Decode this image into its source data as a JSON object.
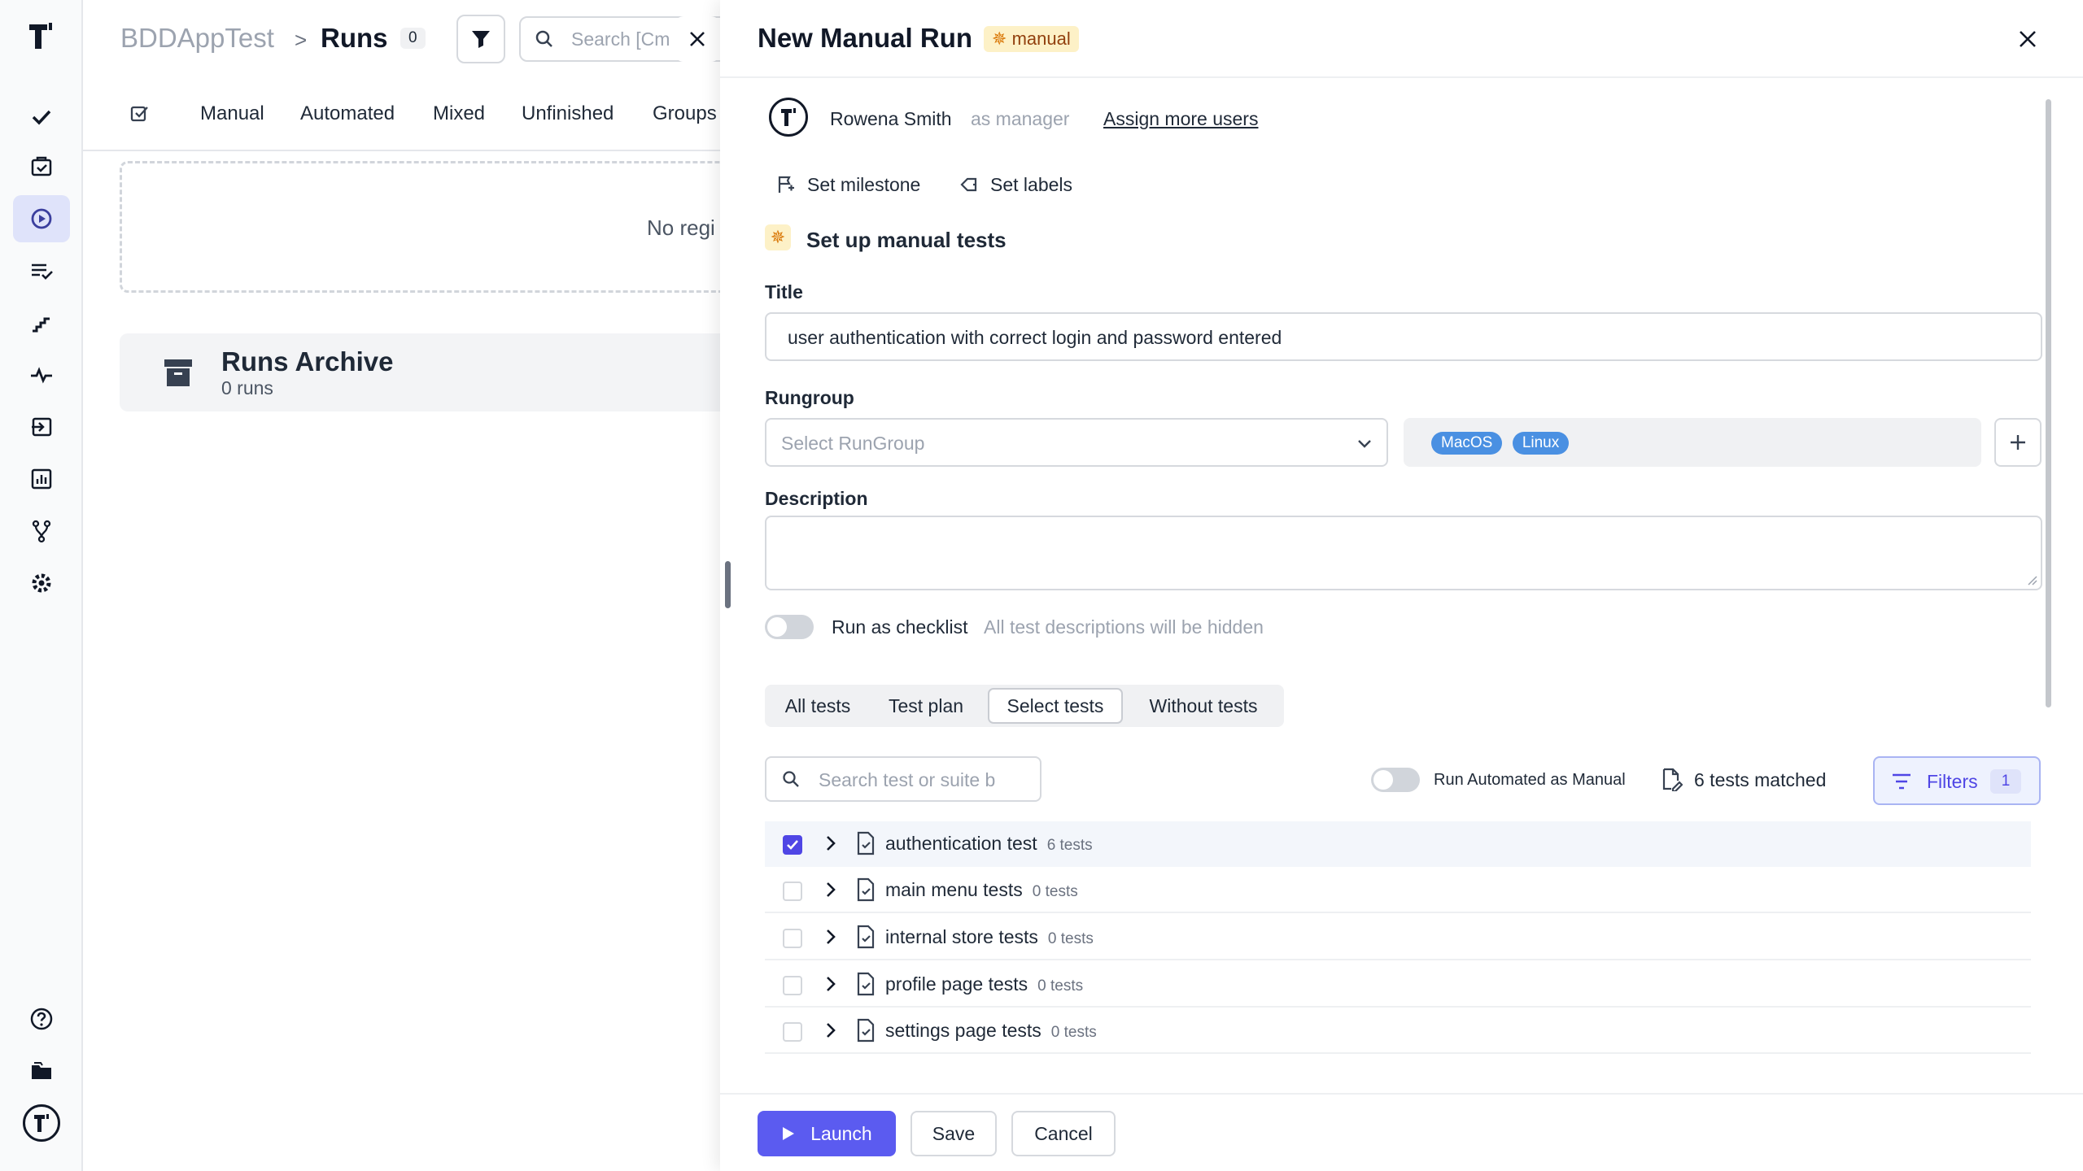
{
  "breadcrumb": {
    "project": "BDDAppTest",
    "separator": ">",
    "page": "Runs",
    "count": "0"
  },
  "search": {
    "placeholder": "Search [Cm"
  },
  "runs_tabs": [
    "Manual",
    "Automated",
    "Mixed",
    "Unfinished",
    "Groups"
  ],
  "empty_text": "No regi",
  "archive": {
    "title": "Runs Archive",
    "subtitle": "0 runs"
  },
  "panel": {
    "title": "New Manual Run",
    "badge": "manual",
    "user": {
      "name": "Rowena Smith",
      "role": "as manager",
      "assign_link": "Assign more users"
    },
    "milestone_label": "Set milestone",
    "labels_label": "Set labels",
    "section_title": "Set up manual tests",
    "title_label": "Title",
    "title_value": "user authentication with correct login and password entered",
    "rungroup_label": "Rungroup",
    "rungroup_placeholder": "Select RunGroup",
    "env_chips": [
      "MacOS",
      "Linux"
    ],
    "description_label": "Description",
    "checklist_label": "Run as checklist",
    "checklist_hint": "All test descriptions will be hidden",
    "scope_tabs": [
      "All tests",
      "Test plan",
      "Select tests",
      "Without tests"
    ],
    "active_scope": "Select tests",
    "search_placeholder": "Search test or suite b",
    "run_automated_label": "Run Automated as Manual",
    "matched": "6 tests matched",
    "filters_label": "Filters",
    "filters_count": "1",
    "suites": [
      {
        "name": "authentication test",
        "count": "6 tests",
        "checked": true
      },
      {
        "name": "main menu tests",
        "count": "0 tests",
        "checked": false
      },
      {
        "name": "internal store tests",
        "count": "0 tests",
        "checked": false
      },
      {
        "name": "profile page tests",
        "count": "0 tests",
        "checked": false
      },
      {
        "name": "settings page tests",
        "count": "0 tests",
        "checked": false
      }
    ],
    "launch_label": "Launch",
    "save_label": "Save",
    "cancel_label": "Cancel"
  },
  "colors": {
    "accent": "#5b5bf0",
    "chip": "#4a90e2",
    "badge_bg": "#fdf1c7",
    "badge_text": "#92400e"
  }
}
